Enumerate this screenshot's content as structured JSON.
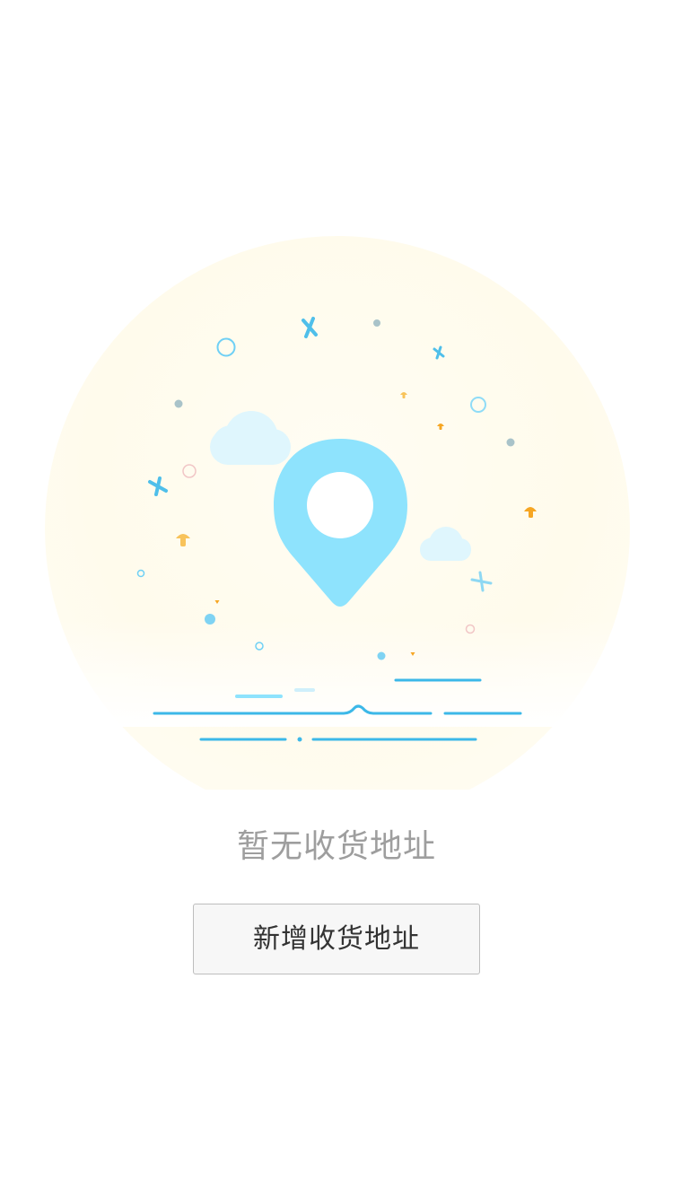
{
  "empty_state": {
    "message": "暂无收货地址",
    "icon": "location-pin-icon"
  },
  "actions": {
    "add_address_label": "新增收货地址"
  },
  "colors": {
    "pin": "#8ee3fd",
    "line": "#3cb8e8",
    "cloud": "#dff6fd",
    "mushroom": "#f6a623",
    "glow": "#fffbea"
  }
}
